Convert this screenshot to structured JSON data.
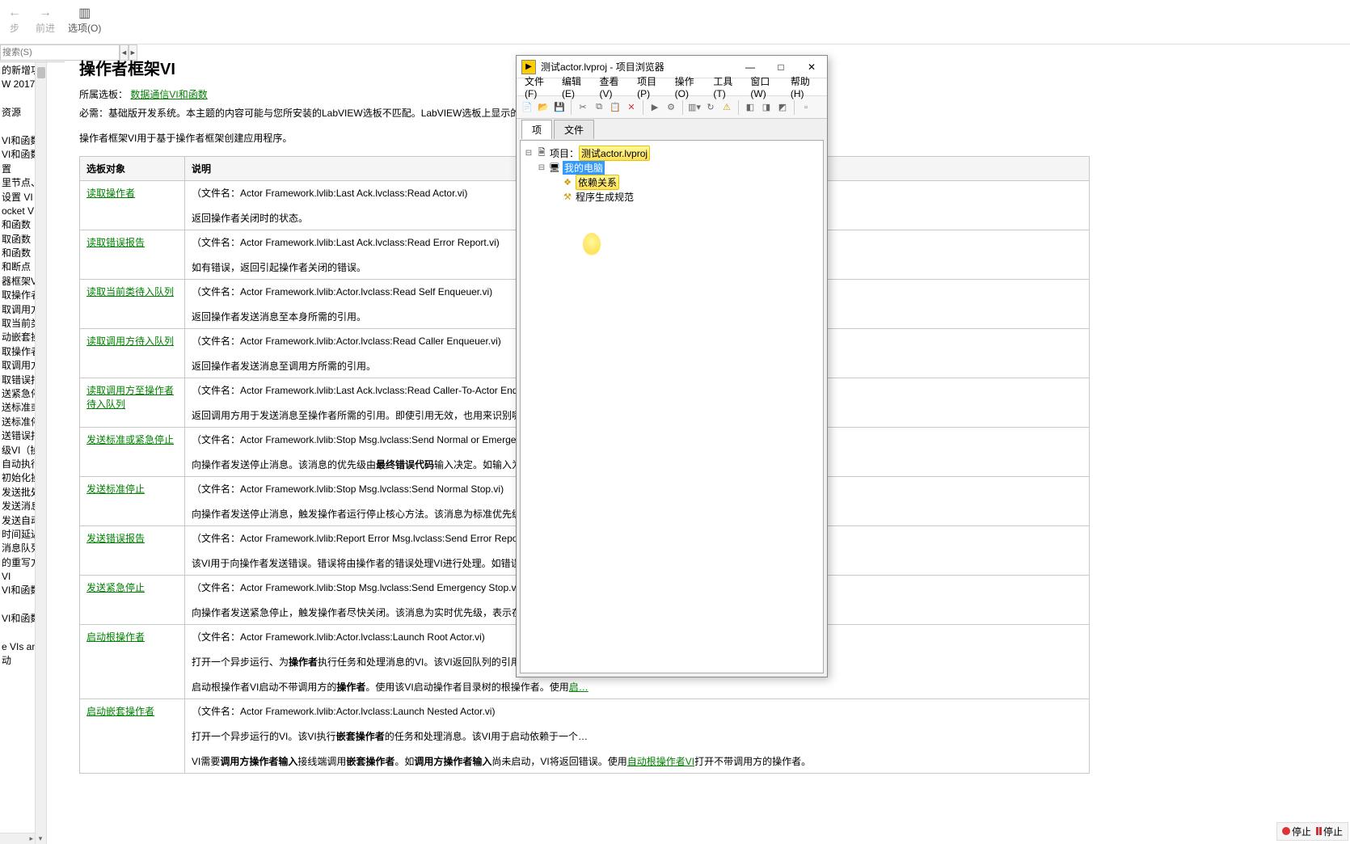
{
  "top": {
    "back": "←",
    "back_l": "步",
    "fwd": "→",
    "fwd_l": "前进",
    "opt": "选项(O)"
  },
  "search": {
    "placeholder": "搜索(S)",
    "prev": "◄",
    "next": "►"
  },
  "sidebar": {
    "items": [
      "的新增功能及",
      "W 2017",
      "",
      "资源",
      "",
      "VI和函数",
      "VI和函数",
      "置",
      "里节点、VI和",
      "设置 VI",
      "ocket VI和函",
      "和函数",
      "取函数",
      "和函数",
      "和断点",
      "器框架VI",
      "取操作者",
      "取调用方待入",
      "取当前类待入",
      "动嵌套操作者",
      "取操作者框",
      "取调用方至操",
      "取错误报告",
      "送紧急停止",
      "送标准或紧急",
      "送标准停止",
      "送错误报告",
      "级VI（操作者",
      "自动执行消息",
      "初始化操作者",
      "发送批处理",
      "发送消息并等",
      "发送自动嵌套",
      "时间延迟发送",
      "消息队列VI",
      "的重写方法",
      "VI",
      "VI和函数",
      "",
      "VI和函数",
      "",
      "e VIs and Fu",
      "动"
    ]
  },
  "help": {
    "title": "操作者框架VI",
    "owning_label": "所属选板：",
    "owning_link": "数据通信VI和函数",
    "req": "必需：基础版开发系统。本主题的内容可能与您所安装的LabVIEW选板不匹配。LabVIEW选板上显示的对象取决于操作…",
    "intro": "操作者框架VI用于基于操作者框架创建应用程序。",
    "th1": "选板对象",
    "th2": "说明",
    "rows": [
      {
        "name": "读取操作者",
        "fn": "Actor Framework.lvlib:Last Ack.lvclass:Read Actor.vi)",
        "desc": "返回操作者关闭时的状态。"
      },
      {
        "name": "读取错误报告",
        "fn": "Actor Framework.lvlib:Last Ack.lvclass:Read Error Report.vi)",
        "desc": "如有错误，返回引起操作者关闭的错误。"
      },
      {
        "name": "读取当前类待入队列",
        "fn": "Actor Framework.lvlib:Actor.lvclass:Read Self Enqueuer.vi)",
        "desc": "返回操作者发送消息至本身所需的引用。"
      },
      {
        "name": "读取调用方待入队列",
        "fn": "Actor Framework.lvlib:Actor.lvclass:Read Caller Enqueuer.vi)",
        "desc": "返回操作者发送消息至调用方所需的引用。"
      },
      {
        "name": "读取调用方至操作者待入队列",
        "fn": "Actor Framework.lvlib:Last Ack.lvclass:Read Caller-To-Actor Enqueue…",
        "desc": "返回调用方用于发送消息至操作者所需的引用。即使引用无效，也用来识别哪一个操作者…"
      },
      {
        "name": "发送标准或紧急停止",
        "fn": "Actor Framework.lvlib:Stop Msg.lvclass:Send Normal or Emergency S…",
        "desc": "向操作者发送停止消息。该消息的优先级由<b>最终错误代码</b>输入决定。如输入为0，该VI发送…"
      },
      {
        "name": "发送标准停止",
        "fn": "Actor Framework.lvlib:Stop Msg.lvclass:Send Normal Stop.vi)",
        "desc": "向操作者发送停止消息，触发操作者运行停止核心方法。该消息为标准优先级，表示操作…"
      },
      {
        "name": "发送错误报告",
        "fn": "Actor Framework.lvlib:Report Error Msg.lvclass:Send Error Report.vi)",
        "desc": "该VI用于向操作者发送错误。错误将由操作者的错误处理VI进行处理。如错误在该处得不到…"
      },
      {
        "name": "发送紧急停止",
        "fn": "Actor Framework.lvlib:Stop Msg.lvclass:Send Emergency Stop.vi)",
        "desc": "向操作者发送紧急停止，触发操作者尽快关闭。该消息为实时优先级，表示在队列中现有…"
      },
      {
        "name": "启动根操作者",
        "fn": "Actor Framework.lvlib:Actor.lvclass:Launch Root Actor.vi)",
        "desc": "打开一个异步运行、为<b>操作者</b>执行任务和处理消息的VI。该VI返回队列的引用，可使用该…",
        "desc2_pre": "启动根操作者VI启动不带调用方的<b>操作者</b>。使用该VI启动操作者目录树的根操作者。使用",
        "desc2_link": "启…"
      },
      {
        "name": "启动嵌套操作者",
        "fn": "Actor Framework.lvlib:Actor.lvclass:Launch Nested Actor.vi)",
        "desc": "打开一个异步运行的VI。该VI执行<b>嵌套操作者</b>的任务和处理消息。该VI用于启动依赖于一个…",
        "desc2_pre": "VI需要<b>调用方操作者输入</b>接线端调用<b>嵌套操作者</b>。如<b>调用方操作者输入</b>尚未启动，VI将返回错误。使用",
        "desc2_link": "自动根操作者VI",
        "desc2_post": "打开不带调用方的操作者。"
      }
    ],
    "fn_label": "（文件名："
  },
  "proj": {
    "title": "测试actor.lvproj - 项目浏览器",
    "menus": [
      "文件(F)",
      "编辑(E)",
      "查看(V)",
      "项目(P)",
      "操作(O)",
      "工具(T)",
      "窗口(W)",
      "帮助(H)"
    ],
    "tabs": [
      "项",
      "文件"
    ],
    "nodes": {
      "root_pre": "项目：",
      "root_name": "测试actor.lvproj",
      "my": "我的电脑",
      "dep": "依赖关系",
      "build": "程序生成规范"
    },
    "win": {
      "min": "—",
      "max": "□",
      "close": "✕"
    }
  },
  "status": {
    "stop": "停止"
  }
}
